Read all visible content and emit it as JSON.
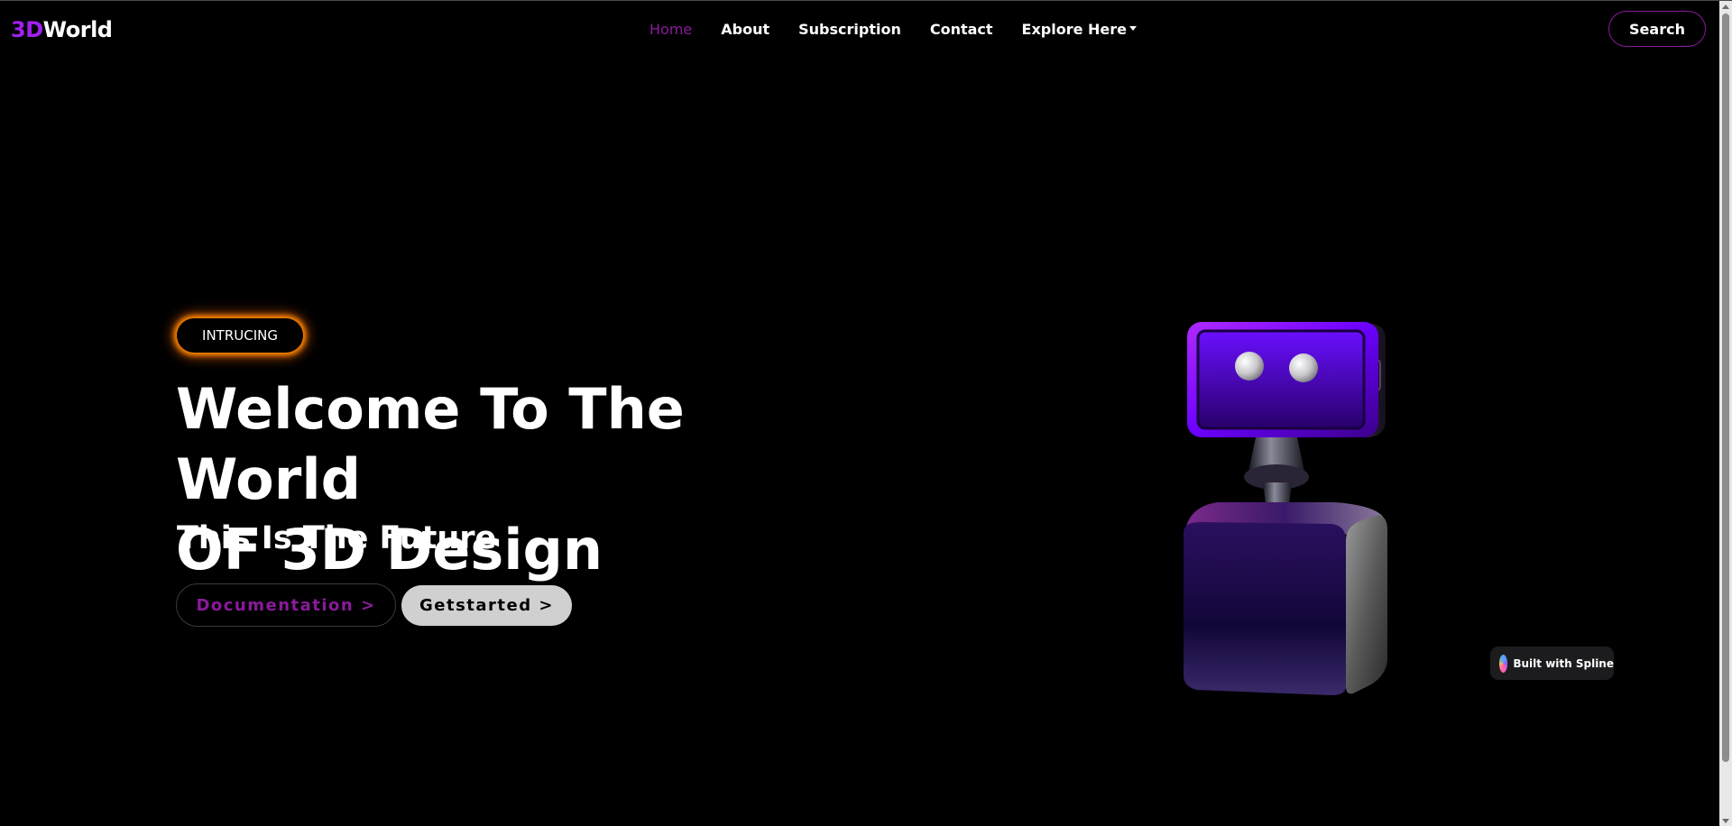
{
  "nav": {
    "logo_accent": "3D",
    "logo_rest": "World",
    "links": [
      "Home",
      "About",
      "Subscription",
      "Contact",
      "Explore Here"
    ],
    "active_link": "Home",
    "search_label": "Search"
  },
  "hero": {
    "badge": "INTRUCING",
    "title_line1": "Welcome To The World",
    "title_line2": "OF 3D Design",
    "subtitle": "This Is The Future",
    "doc_button": "Documentation >",
    "get_started_button": "Getstarted >"
  },
  "spline": {
    "label": "Built with Spline"
  },
  "colors": {
    "accent": "#8a1a9b",
    "logo_accent": "#a020f0",
    "badge_glow": "#ff8a00",
    "background": "#000000"
  },
  "icons": [
    "caret-down-icon",
    "robot-illustration",
    "spline-logo-icon"
  ]
}
